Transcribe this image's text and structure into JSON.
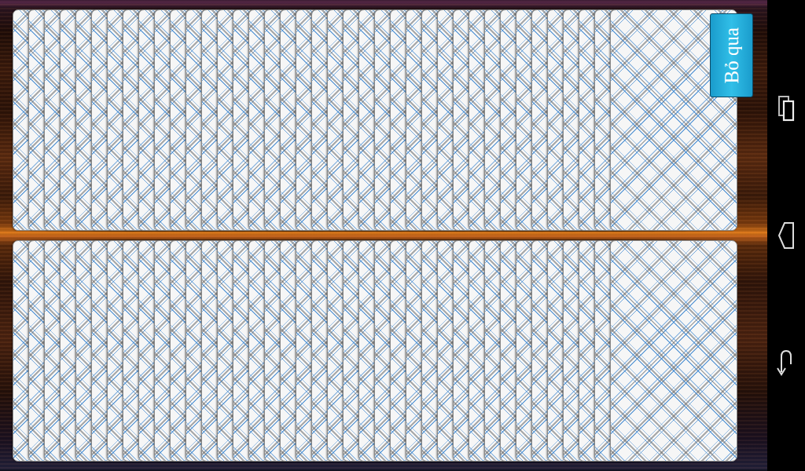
{
  "skip_button": {
    "label": "Bỏ qua"
  },
  "hands": [
    {
      "card_count": 39,
      "face_down": true
    },
    {
      "card_count": 39,
      "face_down": true
    }
  ]
}
